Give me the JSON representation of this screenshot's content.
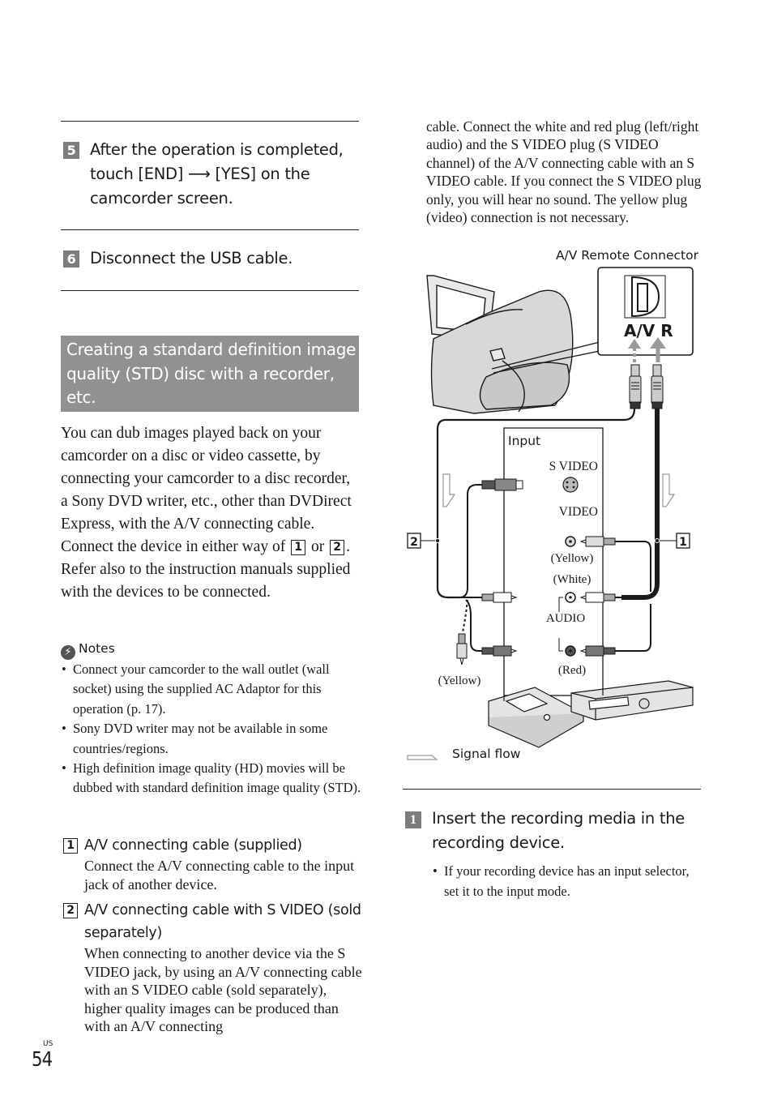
{
  "steps_top": [
    {
      "number": "5",
      "text_before_arrow": "After the operation is completed, touch [END] ",
      "arrow": "⟶",
      "text_after_arrow": " [YES] on the camcorder screen."
    },
    {
      "number": "6",
      "text": "Disconnect the USB cable."
    }
  ],
  "section": {
    "heading": "Creating a standard definition image quality (STD) disc with a recorder, etc.",
    "intro_part1": "You can dub images played back on your camcorder on a disc or video cassette, by connecting your camcorder to a disc recorder, a Sony DVD writer, etc., other than DVDirect Express, with the A/V connecting cable. Connect the device in either way of ",
    "intro_ref1": "1",
    "intro_or": " or ",
    "intro_ref2": "2",
    "intro_part2": ". Refer also to the instruction manuals supplied with the devices to be connected."
  },
  "notes": {
    "icon": "notes-caution-icon",
    "title": "Notes",
    "items": [
      "Connect your camcorder to the wall outlet (wall socket) using the supplied AC Adaptor for this operation (p. 17).",
      "Sony DVD writer may not be available in some countries/regions.",
      "High definition image quality (HD) movies will be dubbed with standard definition image quality (STD)."
    ]
  },
  "cables": [
    {
      "number": "1",
      "title": "A/V connecting cable (supplied)",
      "description": "Connect the A/V connecting cable to the input jack of another device."
    },
    {
      "number": "2",
      "title": "A/V connecting cable with S VIDEO (sold separately)",
      "description": "When connecting to another device via the S VIDEO jack, by using an A/V connecting cable with an S VIDEO cable (sold separately), higher quality images can be produced than with an A/V connecting"
    }
  ],
  "right_column": {
    "continued_text": "cable. Connect the white and red plug (left/right audio) and the S VIDEO plug (S VIDEO channel) of the A/V connecting cable with an S VIDEO cable. If you connect the S VIDEO plug only, you will hear no sound. The yellow plug (video) connection is not necessary."
  },
  "diagram": {
    "connector_title": "A/V Remote Connector",
    "connector_label": "A/V R",
    "input_label": "Input",
    "svideo_label": "S VIDEO",
    "video_label": "VIDEO",
    "yellow_label": "(Yellow)",
    "white_label": "(White)",
    "audio_label": "AUDIO",
    "red_label": "(Red)",
    "yellow_plug_label": "(Yellow)",
    "callout_1": "1",
    "callout_2": "2",
    "legend_label": "Signal flow"
  },
  "step_bottom": {
    "number": "1",
    "text": "Insert the recording media in the recording device.",
    "bullets": [
      "If your recording device has an input selector, set it to the input mode."
    ]
  },
  "footer": {
    "region": "US",
    "page_number": "54"
  }
}
